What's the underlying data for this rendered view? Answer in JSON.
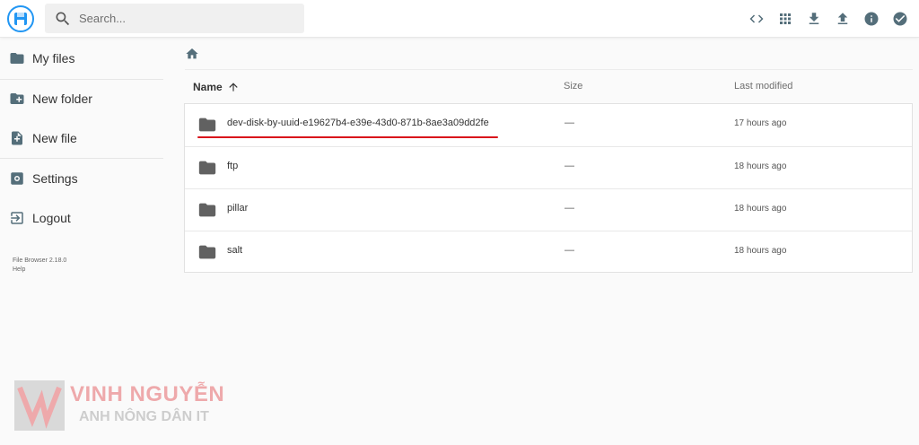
{
  "search": {
    "placeholder": "Search..."
  },
  "header": {
    "actions": [
      {
        "icon": "code-icon"
      },
      {
        "icon": "grid-view-icon"
      },
      {
        "icon": "download-icon"
      },
      {
        "icon": "upload-icon"
      },
      {
        "icon": "info-icon"
      },
      {
        "icon": "check-circle-icon"
      }
    ],
    "accent_color": "#2196f3"
  },
  "sidebar": {
    "items": [
      {
        "label": "My files",
        "icon": "folder-icon"
      },
      {
        "label": "New folder",
        "icon": "new-folder-icon"
      },
      {
        "label": "New file",
        "icon": "new-file-icon"
      },
      {
        "label": "Settings",
        "icon": "settings-icon"
      },
      {
        "label": "Logout",
        "icon": "logout-icon"
      }
    ],
    "version": "File Browser 2.18.0",
    "help": "Help"
  },
  "breadcrumb": {
    "icon": "home-icon"
  },
  "columns": {
    "name": "Name",
    "size": "Size",
    "modified": "Last modified"
  },
  "files": [
    {
      "name": "dev-disk-by-uuid-e19627b4-e39e-43d0-871b-8ae3a09dd2fe",
      "size": "—",
      "modified": "17 hours ago"
    },
    {
      "name": "ftp",
      "size": "—",
      "modified": "18 hours ago"
    },
    {
      "name": "pillar",
      "size": "—",
      "modified": "18 hours ago"
    },
    {
      "name": "salt",
      "size": "—",
      "modified": "18 hours ago"
    }
  ],
  "highlight_color": "#d9141c",
  "watermark": {
    "title": "VINH NGUYỄN",
    "subtitle": "ANH NÔNG DÂN IT"
  }
}
